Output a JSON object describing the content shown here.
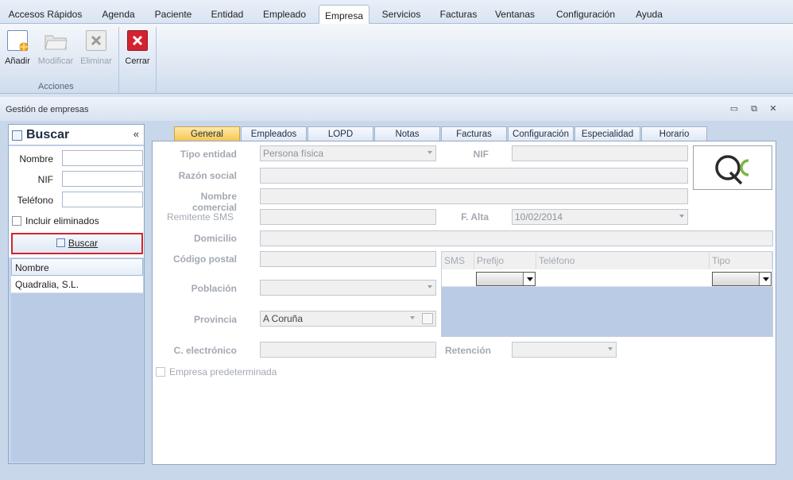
{
  "menu": {
    "items": [
      "Accesos Rápidos",
      "Agenda",
      "Paciente",
      "Entidad",
      "Empleado",
      "Empresa",
      "Servicios",
      "Facturas",
      "Ventanas",
      "Configuración",
      "Ayuda"
    ],
    "active": "Empresa"
  },
  "ribbon": {
    "add_label": "Añadir",
    "modify_label": "Modificar",
    "delete_label": "Eliminar",
    "close_label": "Cerrar",
    "group_label": "Acciones"
  },
  "window": {
    "title": "Gestión de empresas"
  },
  "search_panel": {
    "title": "Buscar",
    "name_label": "Nombre",
    "nif_label": "NIF",
    "phone_label": "Teléfono",
    "include_deleted_label": "Incluir eliminados",
    "button_label": "Buscar",
    "results_header": "Nombre",
    "results": [
      "Quadralia, S.L."
    ]
  },
  "tabs": [
    "General",
    "Empleados",
    "LOPD",
    "Notas",
    "Facturas",
    "Configuración",
    "Especialidad",
    "Horario"
  ],
  "form": {
    "tipo_entidad_label": "Tipo entidad",
    "tipo_entidad_value": "Persona física",
    "nif_label": "NIF",
    "razon_social_label": "Razón social",
    "nombre_comercial_label": "Nombre comercial",
    "remitente_sms_label": "Remitente SMS",
    "f_alta_label": "F. Alta",
    "f_alta_value": "10/02/2014",
    "domicilio_label": "Domicilio",
    "codigo_postal_label": "Código postal",
    "poblacion_label": "Población",
    "provincia_label": "Provincia",
    "provincia_value": "A Coruña",
    "email_label": "C. electrónico",
    "retencion_label": "Retención",
    "default_company_label": "Empresa predeterminada"
  },
  "phones": {
    "col_sms": "SMS",
    "col_prefix": "Prefijo",
    "col_phone": "Teléfono",
    "col_type": "Tipo"
  },
  "colors": {
    "active_tab": "#f7c54e",
    "close_red": "#d4232f",
    "highlight_border": "#d4232f",
    "logo_green": "#7ab648"
  }
}
